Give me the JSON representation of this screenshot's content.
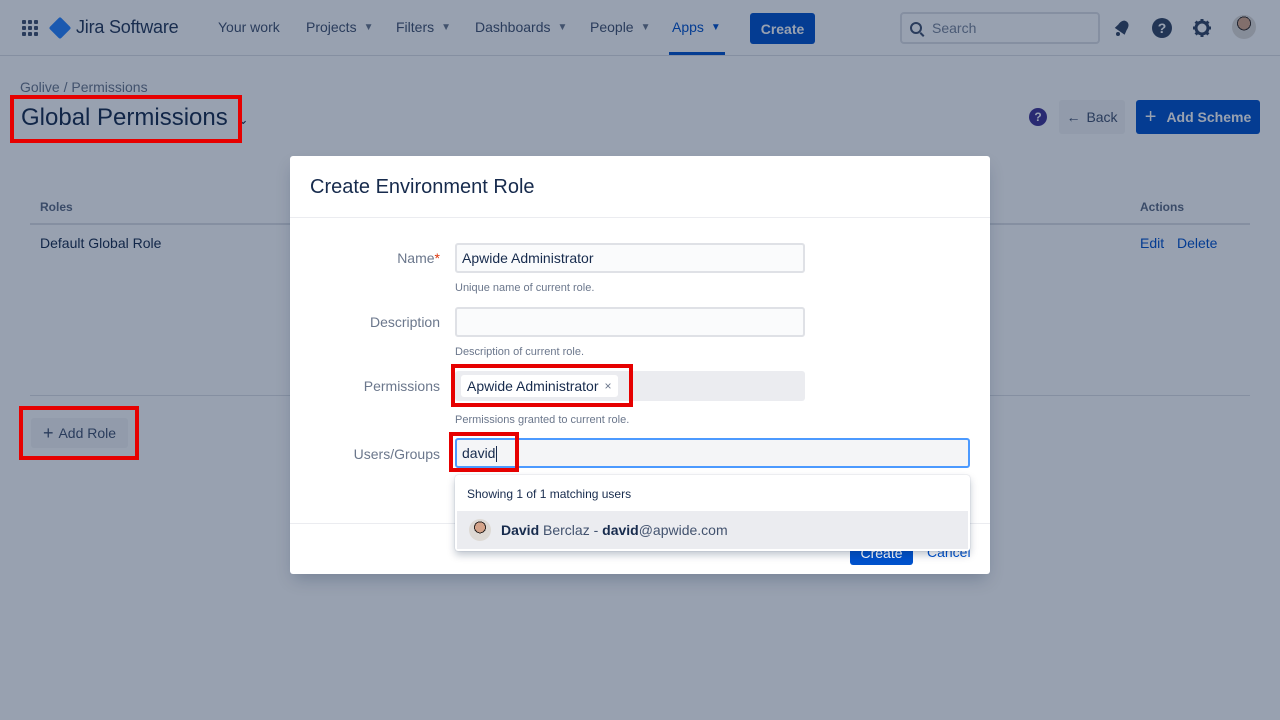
{
  "nav": {
    "logo_text": "Jira Software",
    "items": [
      {
        "label": "Your work"
      },
      {
        "label": "Projects"
      },
      {
        "label": "Filters"
      },
      {
        "label": "Dashboards"
      },
      {
        "label": "People"
      },
      {
        "label": "Apps"
      }
    ],
    "create_label": "Create",
    "search_placeholder": "Search",
    "help_glyph": "?",
    "chevron_glyph": "⌄",
    "icons": [
      "app-switcher-icon",
      "jira-logo-icon",
      "search-icon",
      "notifications-icon",
      "help-icon",
      "settings-icon",
      "avatar"
    ]
  },
  "page": {
    "breadcrumb": "Golive / Permissions",
    "title": "Global Permissions",
    "back_label": "Back",
    "back_glyph": "←",
    "add_scheme_label": "Add Scheme",
    "plus_glyph": "+",
    "columns": {
      "roles": "Roles",
      "actions": "Actions"
    },
    "rows": [
      {
        "role": "Default Global Role",
        "edit": "Edit",
        "delete": "Delete"
      }
    ],
    "add_role_label": "Add Role"
  },
  "dialog": {
    "title": "Create Environment Role",
    "name_label": "Name",
    "required_mark": "*",
    "name_value": "Apwide Administrator",
    "name_help": "Unique name of current role.",
    "description_label": "Description",
    "description_value": "",
    "description_help": "Description of current role.",
    "permissions_label": "Permissions",
    "permissions_chip": "Apwide Administrator",
    "chip_remove_glyph": "×",
    "permissions_help": "Permissions granted to current role.",
    "users_label": "Users/Groups",
    "users_value": "david",
    "create_label": "Create",
    "cancel_label": "Cancel"
  },
  "dropdown": {
    "header": "Showing 1 of 1 matching users",
    "result": {
      "first": "David",
      "last": " Berclaz - ",
      "email_user": "david",
      "email_domain": "@apwide.com"
    }
  },
  "colors": {
    "brand": "#0052cc",
    "annotation": "#e60000",
    "overlay": "rgba(9,30,66,0.42)"
  }
}
